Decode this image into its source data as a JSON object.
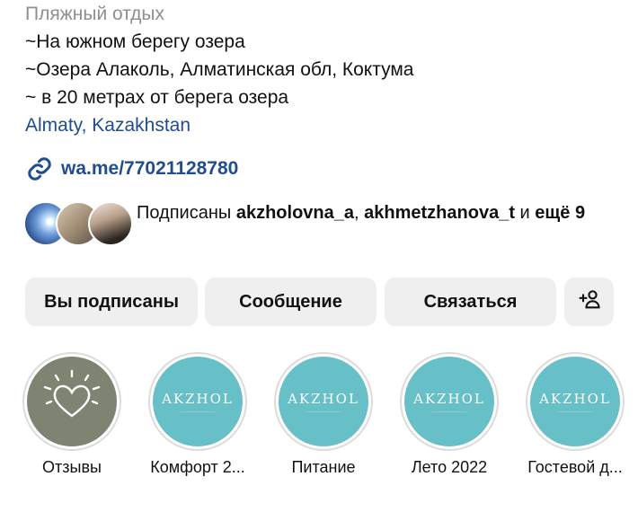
{
  "profile": {
    "category": "Пляжный отдых",
    "bio": [
      "~На южном берегу озера",
      "~Озера Алаколь, Алматинская обл, Коктума",
      "~ в 20 метрах от берега озера"
    ],
    "location": "Almaty, Kazakhstan",
    "link": "wa.me/77021128780",
    "link_icon": "link-icon"
  },
  "followers": {
    "prefix": "Подписаны ",
    "user1": "akzholovna_a",
    "sep": ", ",
    "user2": "akhmetzhanova_t",
    "middle": " и ",
    "more": "ещё 9"
  },
  "actions": {
    "following": "Вы подписаны",
    "message": "Сообщение",
    "contact": "Связаться",
    "add_person_icon": "add-person-icon"
  },
  "highlights": [
    {
      "label": "Отзывы",
      "icon": "heart-icon",
      "color": "#7d8472"
    },
    {
      "label": "Комфорт 2...",
      "brand": "AKZHOL",
      "color": "#67bfc7"
    },
    {
      "label": "Питание",
      "brand": "AKZHOL",
      "color": "#67bfc7"
    },
    {
      "label": "Лето 2022",
      "brand": "AKZHOL",
      "color": "#67bfc7"
    },
    {
      "label": "Гостевой д...",
      "brand": "AKZHOL",
      "color": "#67bfc7"
    }
  ],
  "colors": {
    "link_blue": "#1f4d8f",
    "secondary_text": "#8e8e93",
    "button_bg": "#efefef"
  }
}
